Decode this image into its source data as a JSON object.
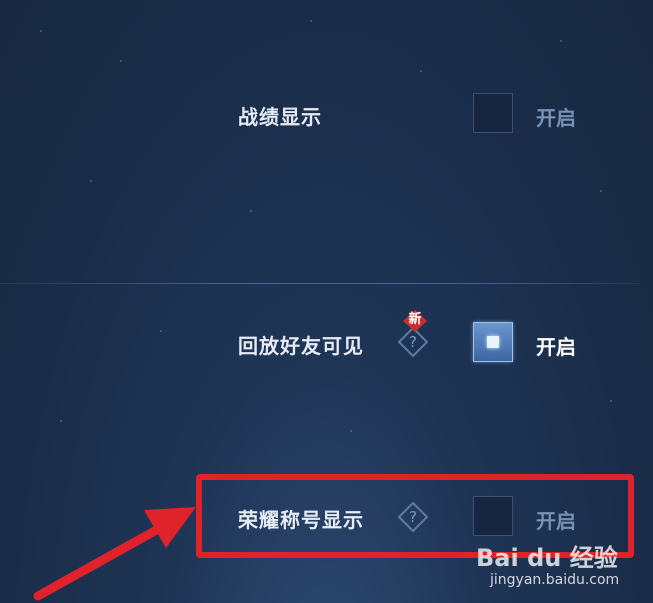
{
  "settings": [
    {
      "label": "战绩显示",
      "toggle_label": "开启",
      "checked": false,
      "has_help": false,
      "has_new_badge": false
    },
    {
      "label": "回放好友可见",
      "toggle_label": "开启",
      "checked": true,
      "has_help": true,
      "has_new_badge": true,
      "badge_text": "新"
    },
    {
      "label": "荣耀称号显示",
      "toggle_label": "开启",
      "checked": false,
      "has_help": true,
      "has_new_badge": false
    }
  ],
  "help_icon": {
    "glyph": "?",
    "icon": "question-icon"
  },
  "annotation": {
    "box_color": "#e0222a",
    "arrow_color": "#e0222a"
  },
  "watermark": {
    "logo_text": "Bai du 经验",
    "url": "jingyan.baidu.com"
  },
  "colors": {
    "bg": "#1f3556",
    "label": "#e6ecf5",
    "toggle_dim": "#7a92b6",
    "toggle_on": "#ffffff"
  }
}
